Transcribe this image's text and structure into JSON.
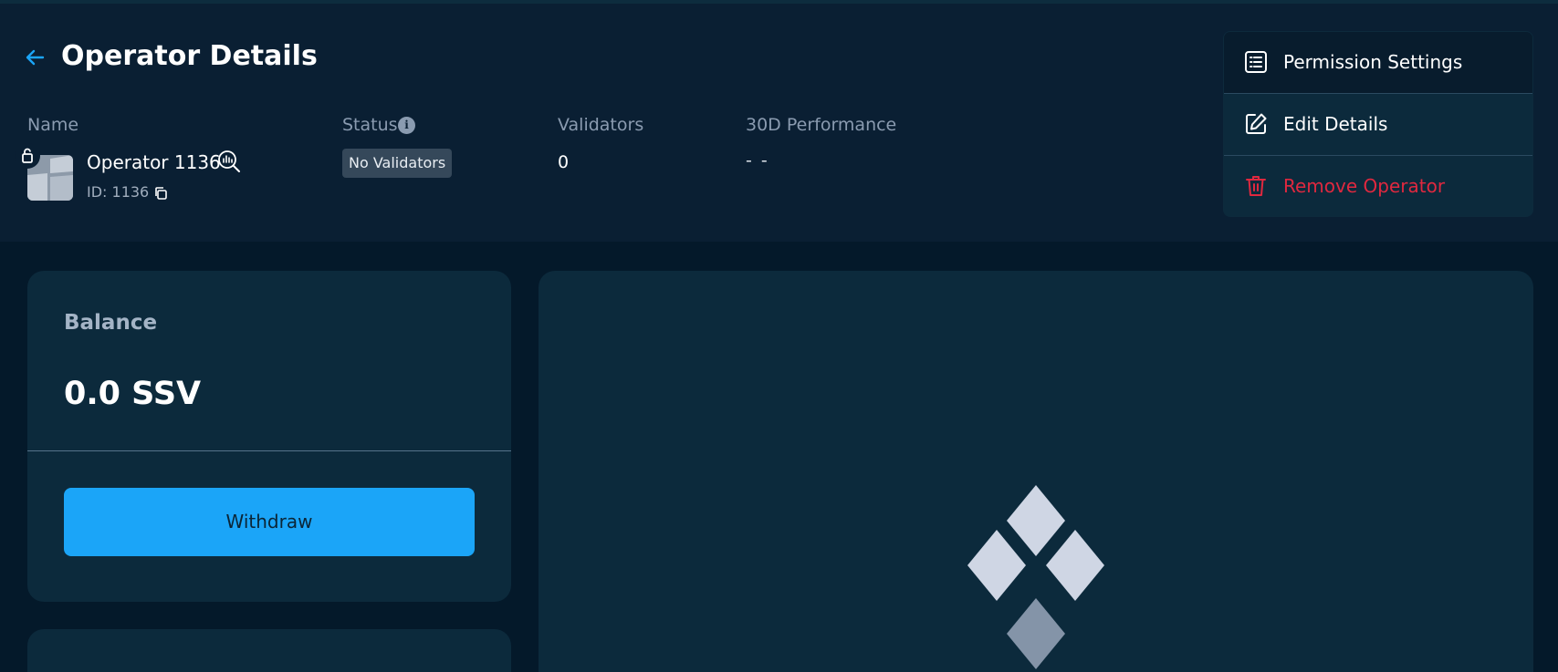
{
  "header": {
    "title": "Operator Details",
    "columns": {
      "name": "Name",
      "status": "Status",
      "validators": "Validators",
      "performance": "30D Performance"
    },
    "operator": {
      "name": "Operator 1136",
      "id": "ID: 1136",
      "status": "No Validators",
      "validators": "0",
      "performance": "- -"
    }
  },
  "menu": {
    "items": [
      {
        "label": "Permission Settings",
        "icon": "list-icon"
      },
      {
        "label": "Edit Details",
        "icon": "edit-icon"
      },
      {
        "label": "Remove Operator",
        "icon": "trash-icon",
        "color": "#e0283f"
      }
    ]
  },
  "balance": {
    "title": "Balance",
    "value": "0.0 SSV",
    "withdraw_label": "Withdraw"
  },
  "colors": {
    "accent": "#1ba5f8",
    "danger": "#e0283f",
    "background": "#04192a",
    "card": "#0c2a3c"
  }
}
